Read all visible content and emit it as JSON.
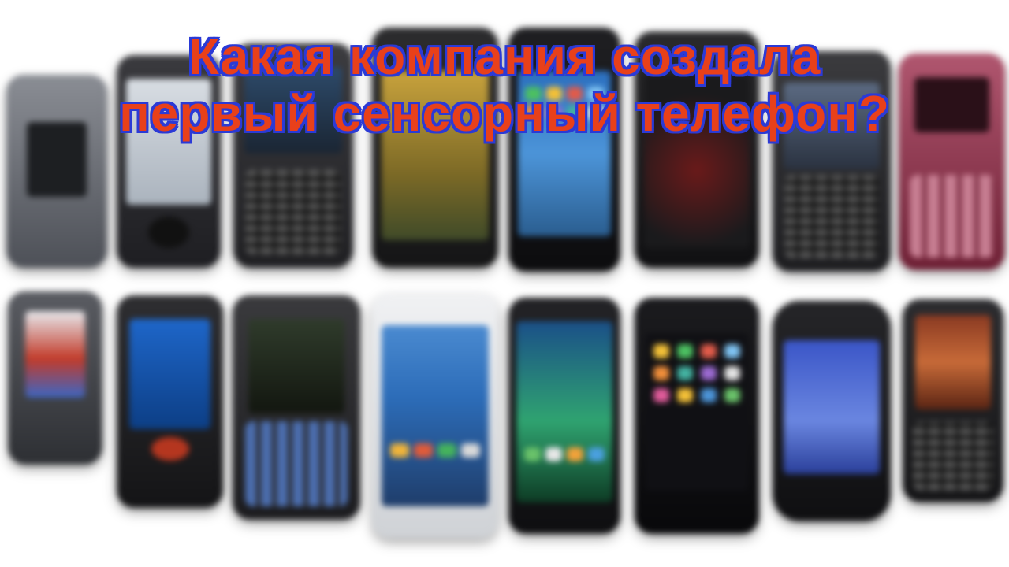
{
  "title": {
    "line1": "Какая компания создала",
    "line2": "первый сенсорный телефон?"
  },
  "colors": {
    "title_fill": "#e8401a",
    "title_outline": "#2b3ad6",
    "background": "#ffffff"
  },
  "phones": {
    "top_row": [
      "flip-phone-gray",
      "touch-phone-silver",
      "keyboard-phone-black",
      "android-phone-htc",
      "iphone-black",
      "android-phone-dark",
      "blackberry-phone",
      "bar-phone-red"
    ],
    "bottom_row": [
      "flip-phone-open",
      "slider-phone-blue",
      "qwerty-phone-samsung",
      "galaxy-phone-white",
      "lg-phone-black",
      "iphone-black",
      "android-phone-black",
      "bar-phone-dark"
    ]
  }
}
